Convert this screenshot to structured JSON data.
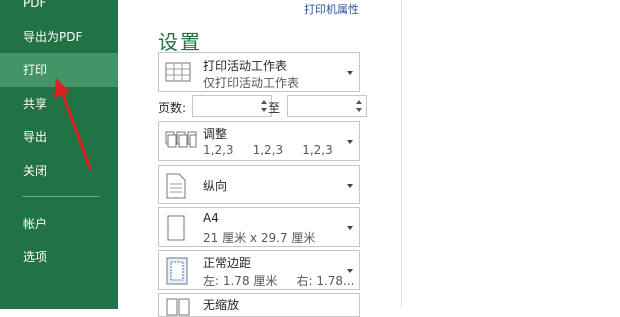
{
  "sidebar": {
    "items": [
      {
        "label": "PDF"
      },
      {
        "label": "导出为PDF"
      },
      {
        "label": "打印"
      },
      {
        "label": "共享"
      },
      {
        "label": "导出"
      },
      {
        "label": "关闭"
      },
      {
        "label": "帐户"
      },
      {
        "label": "选项"
      }
    ]
  },
  "header": {
    "printer_properties": "打印机属性"
  },
  "settings": {
    "title": "设置",
    "print_scope": {
      "title": "打印活动工作表",
      "subtitle": "仅打印活动工作表"
    },
    "pages": {
      "label": "页数:",
      "to_label": "至",
      "from_value": "",
      "to_value": ""
    },
    "collate": {
      "title": "调整",
      "subtitle": "1,2,3     1,2,3     1,2,3"
    },
    "orientation": {
      "title": "纵向"
    },
    "paper": {
      "title": "A4",
      "subtitle": "21 厘米 x 29.7 厘米"
    },
    "margins": {
      "title": "正常边距",
      "subtitle": "左: 1.78 厘米     右: 1.78..."
    },
    "scaling": {
      "title": "无缩放"
    }
  },
  "colors": {
    "accent": "#217346",
    "sidebar_active": "#439467",
    "annotation": "#e02020"
  }
}
